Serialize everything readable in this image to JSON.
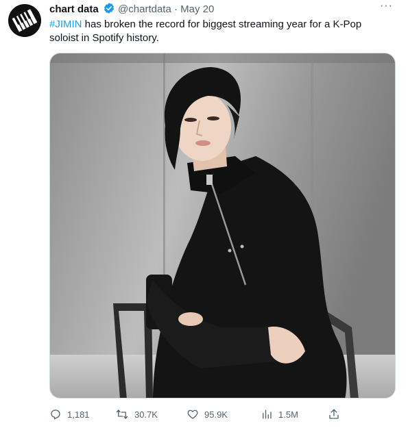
{
  "tweet": {
    "author_name": "chart data",
    "author_handle": "@chartdata",
    "separator": "·",
    "date": "May 20",
    "more_label": "···",
    "hashtag": "#JIMIN",
    "body": " has broken the record for biggest streaming year for a K-Pop soloist in Spotify history.",
    "avatar_icon": "piano-keys-logo",
    "verified_icon": "verified-badge-icon",
    "accent_color": "#1d9bf0"
  },
  "actions": {
    "replies": "1,181",
    "retweets": "30.7K",
    "likes": "95.9K",
    "views": "1.5M"
  }
}
